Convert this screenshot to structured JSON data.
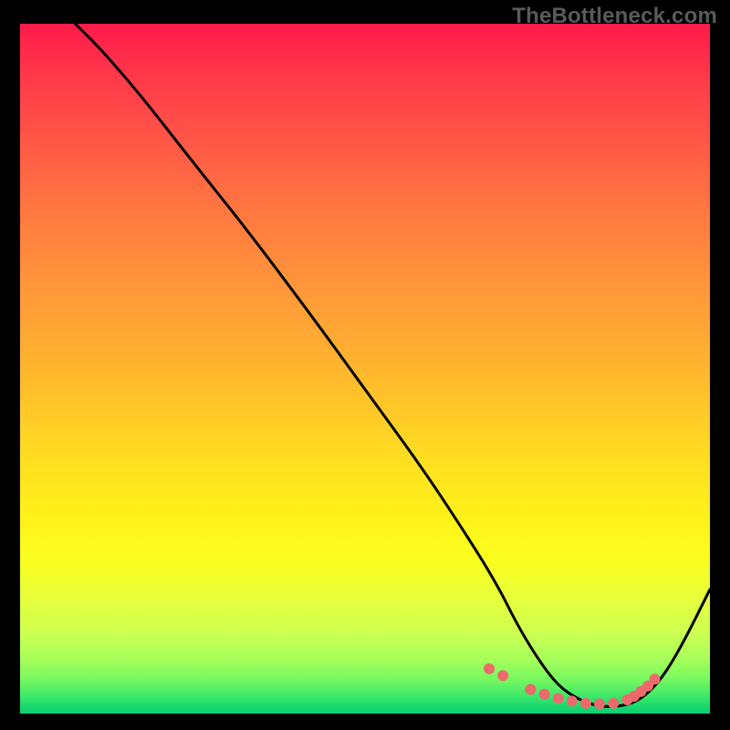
{
  "watermark": "TheBottleneck.com",
  "chart_data": {
    "type": "line",
    "title": "",
    "xlabel": "",
    "ylabel": "",
    "xlim": [
      0,
      100
    ],
    "ylim": [
      0,
      100
    ],
    "series": [
      {
        "name": "bottleneck-curve",
        "x": [
          8,
          12,
          18,
          25,
          33,
          42,
          50,
          58,
          64,
          69,
          72,
          75,
          78,
          81,
          84,
          87,
          90,
          93,
          96,
          100
        ],
        "y": [
          100,
          96,
          89,
          80,
          70,
          58,
          47,
          36,
          27,
          19,
          13,
          8,
          4,
          2,
          1,
          1,
          2,
          5,
          10,
          18
        ]
      }
    ],
    "markers": {
      "name": "highlight-points",
      "x": [
        68,
        70,
        74,
        76,
        78,
        80,
        82,
        84,
        86,
        88,
        89,
        90,
        91,
        92
      ],
      "y": [
        6.5,
        5.5,
        3.5,
        2.8,
        2.2,
        1.8,
        1.5,
        1.4,
        1.5,
        2.0,
        2.5,
        3.2,
        4.0,
        5.0
      ],
      "color": "#ec6a6d",
      "size": 6
    }
  }
}
